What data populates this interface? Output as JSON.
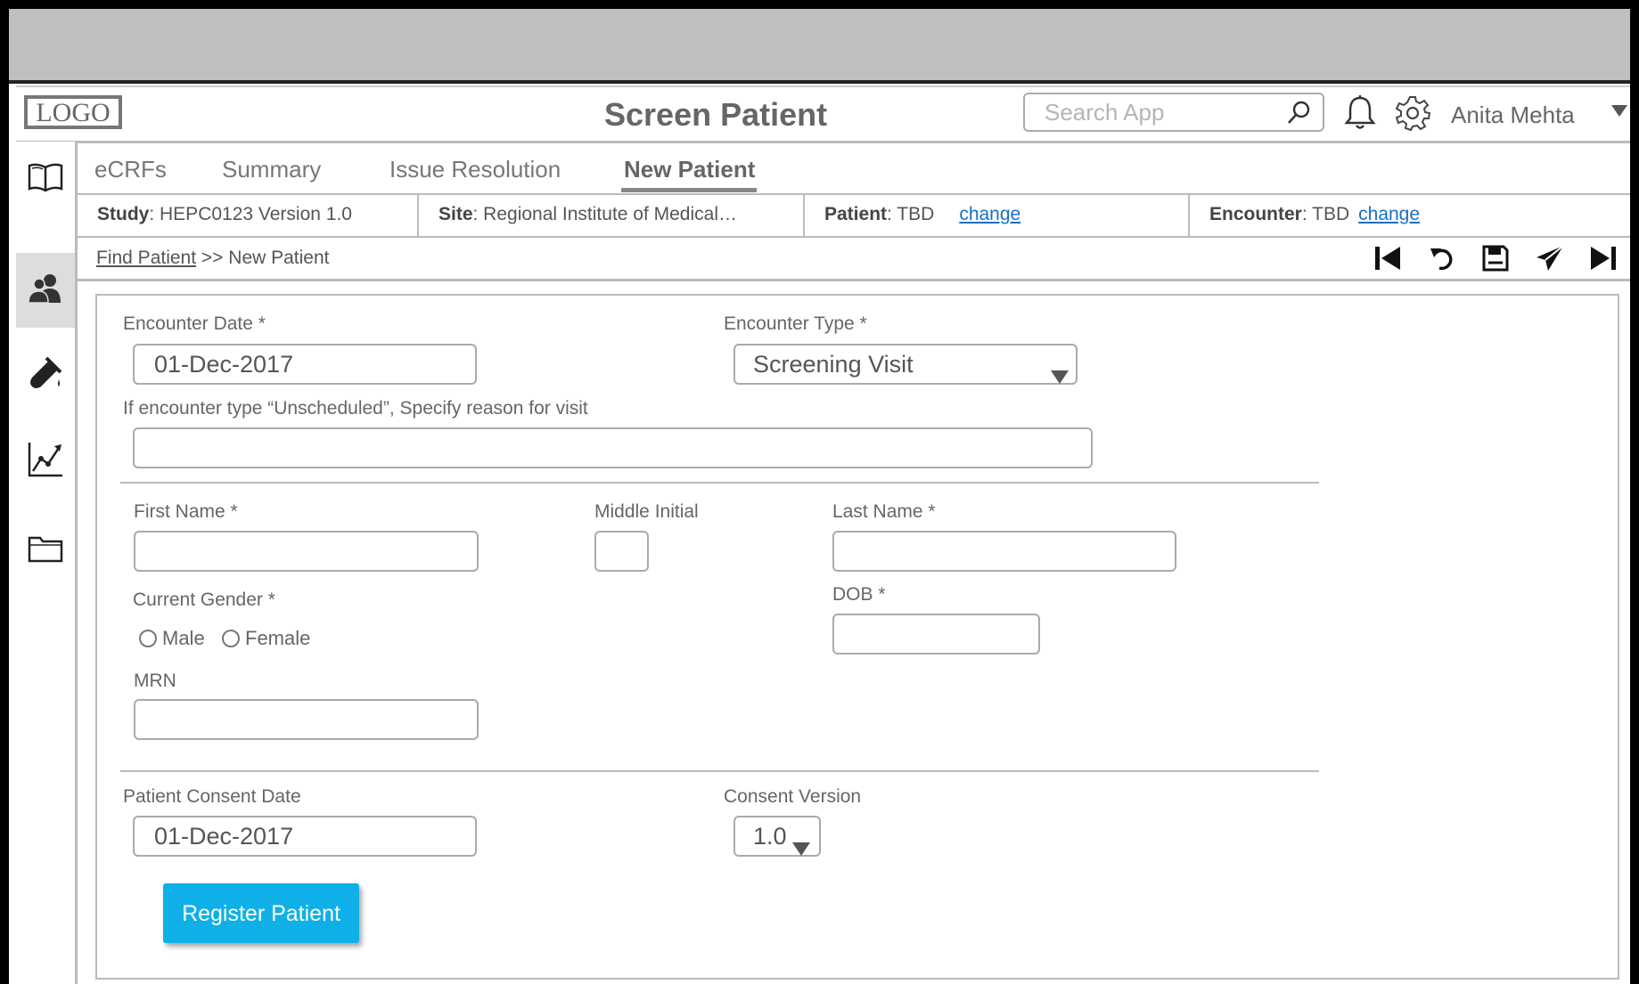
{
  "header": {
    "logo_text": "LOGO",
    "title": "Screen Patient",
    "search_placeholder": "Search App",
    "user_name": "Anita Mehta"
  },
  "sidebar": {
    "items": [
      {
        "icon": "book-icon"
      },
      {
        "icon": "users-icon",
        "active": true
      },
      {
        "icon": "lab-tube-icon"
      },
      {
        "icon": "chart-icon"
      },
      {
        "icon": "folder-icon"
      }
    ]
  },
  "tabs": [
    {
      "label": "eCRFs"
    },
    {
      "label": "Summary"
    },
    {
      "label": "Issue Resolution"
    },
    {
      "label": "New Patient",
      "active": true
    }
  ],
  "info": {
    "study_label": "Study",
    "study_value": ": HEPC0123 Version 1.0",
    "site_label": "Site",
    "site_value": ": Regional Institute of Medical…",
    "patient_label": "Patient",
    "patient_value": ": TBD",
    "patient_change": "change",
    "encounter_label": "Encounter",
    "encounter_value": ": TBD",
    "encounter_change": "change"
  },
  "breadcrumb": {
    "link": "Find Patient",
    "rest": " >> New Patient"
  },
  "toolbar": [
    "first-icon",
    "undo-icon",
    "save-icon",
    "send-icon",
    "last-icon"
  ],
  "form": {
    "encounter_date_label": "Encounter Date *",
    "encounter_date_value": "01-Dec-2017",
    "encounter_type_label": "Encounter Type *",
    "encounter_type_value": "Screening Visit",
    "reason_label": "If encounter type “Unscheduled”, Specify reason for visit",
    "reason_value": "",
    "first_name_label": "First Name *",
    "middle_initial_label": "Middle Initial",
    "last_name_label": "Last Name *",
    "gender_label": "Current Gender *",
    "gender_male": "Male",
    "gender_female": "Female",
    "dob_label": "DOB *",
    "mrn_label": "MRN",
    "consent_date_label": "Patient Consent Date",
    "consent_date_value": "01-Dec-2017",
    "consent_version_label": "Consent Version",
    "consent_version_value": "1.0",
    "register_button": "Register Patient"
  },
  "colors": {
    "accent": "#0fb0e8",
    "link": "#1a6fc4"
  }
}
